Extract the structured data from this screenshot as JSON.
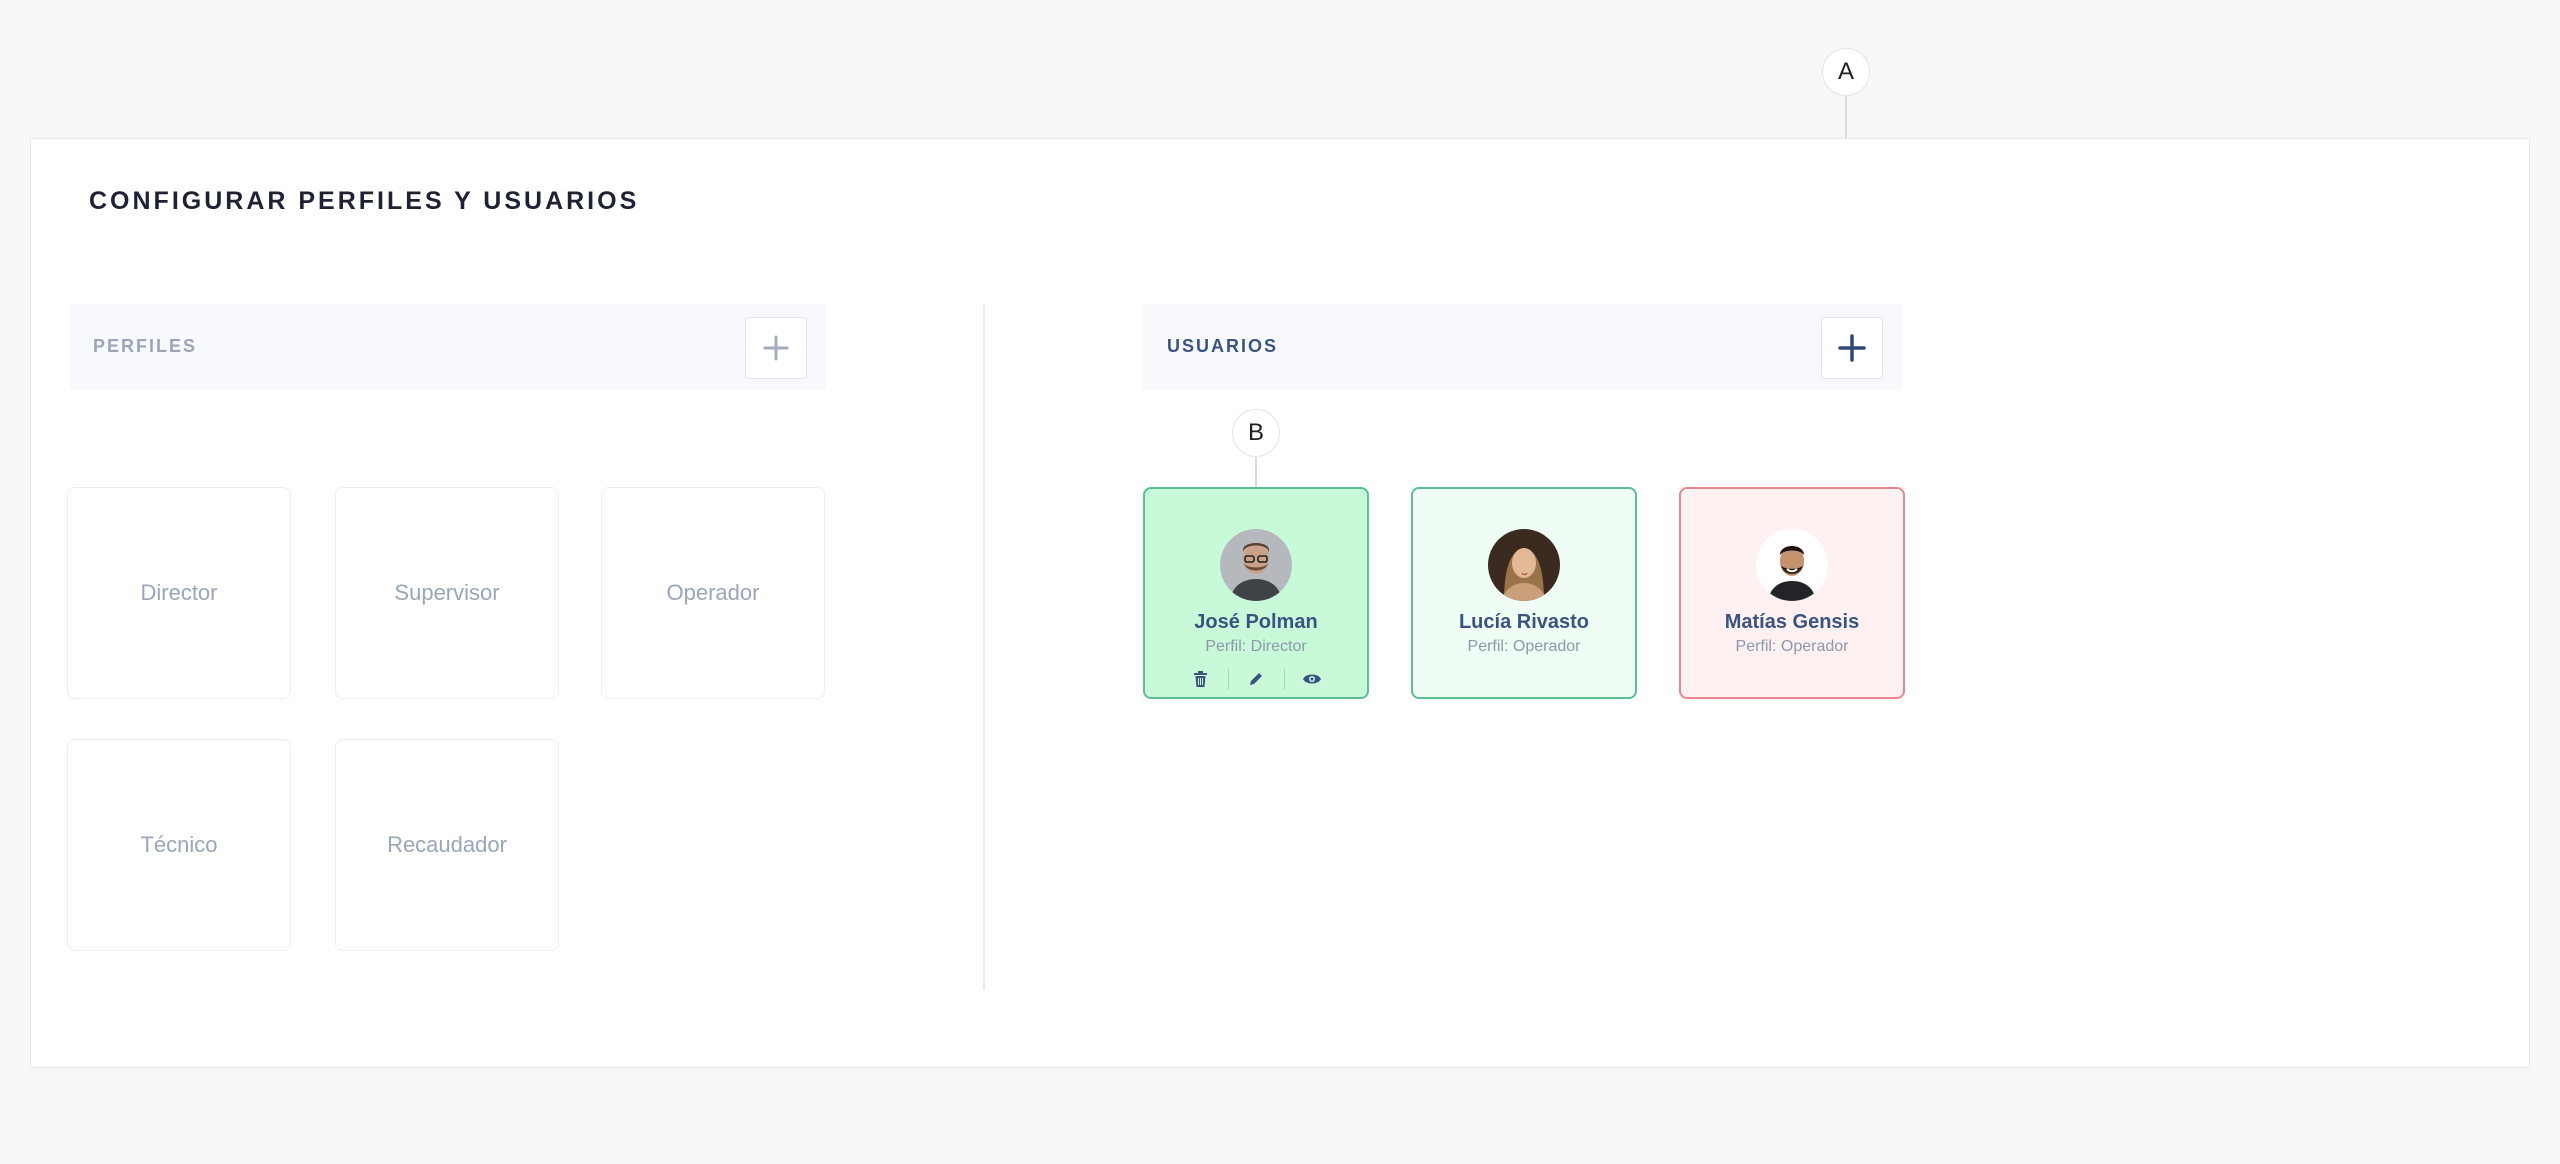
{
  "page": {
    "title": "CONFIGURAR PERFILES Y USUARIOS"
  },
  "profiles": {
    "header": "PERFILES",
    "items": [
      "Director",
      "Supervisor",
      "Operador",
      "Técnico",
      "Recaudador"
    ]
  },
  "users": {
    "header": "USUARIOS",
    "items": [
      {
        "name": "José Polman",
        "profile": "Perfil: Director",
        "status": "selected"
      },
      {
        "name": "Lucía Rivasto",
        "profile": "Perfil: Operador",
        "status": "active"
      },
      {
        "name": "Matías Gensis",
        "profile": "Perfil: Operador",
        "status": "inactive"
      }
    ]
  },
  "callouts": {
    "a": "A",
    "b": "B"
  },
  "icons": {
    "add": "plus-icon",
    "delete": "trash-icon",
    "edit": "pencil-icon",
    "view": "eye-icon"
  },
  "colors": {
    "accent": "#3a5480",
    "active_border": "#5cbf94",
    "active_bg": "#effdf5",
    "selected_bg": "#c8fad9",
    "inactive_border": "#e8888c",
    "inactive_bg": "#fff1f1",
    "muted": "#9aa6b8"
  }
}
